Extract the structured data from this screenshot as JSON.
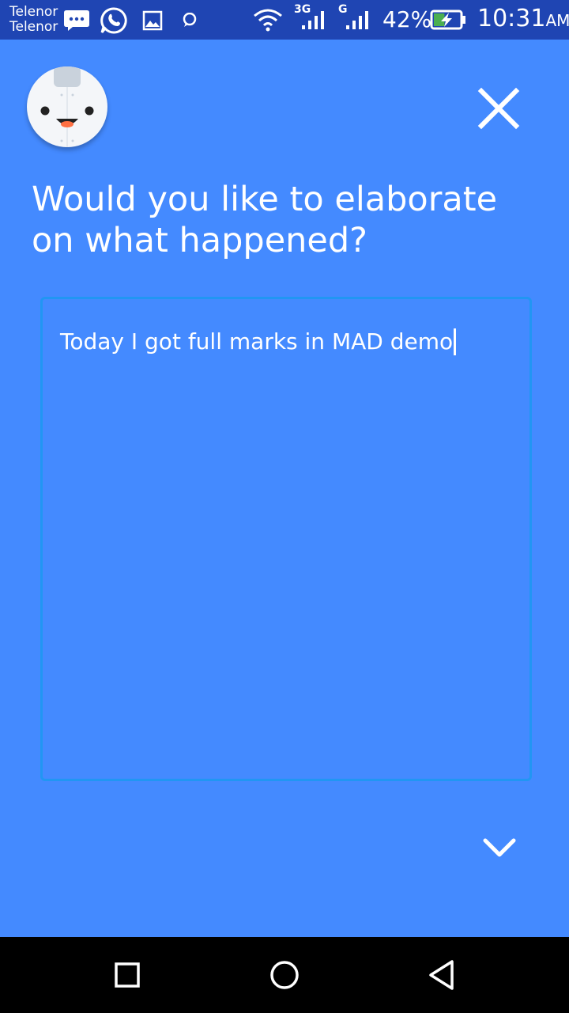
{
  "status_bar": {
    "carrier_1": "Telenor",
    "carrier_2": "Telenor",
    "network_1": "3G",
    "network_2": "G",
    "battery_percent": "42%",
    "battery_level": 0.42,
    "time": "10:31",
    "time_ampm": "AM",
    "notification_icons": [
      "message-icon",
      "whatsapp-icon",
      "gallery-icon",
      "chat-bubble-icon"
    ],
    "system_icons": [
      "wifi-icon",
      "signal-icon",
      "signal-icon",
      "battery-charging-icon"
    ]
  },
  "mascot": "bot-avatar",
  "header": {
    "close_icon": "close-icon"
  },
  "prompt": {
    "question": "Would you like to elaborate on what happened?"
  },
  "entry": {
    "value": "Today I got full marks in MAD demo"
  },
  "footer": {
    "next_icon": "chevron-down-icon"
  },
  "nav_bar": {
    "icons": [
      "recent-apps-icon",
      "home-icon",
      "back-icon"
    ]
  },
  "colors": {
    "background": "#448aff",
    "status_bar": "#1f45b3",
    "input_border": "#2196f3",
    "nav_bar": "#000000"
  }
}
